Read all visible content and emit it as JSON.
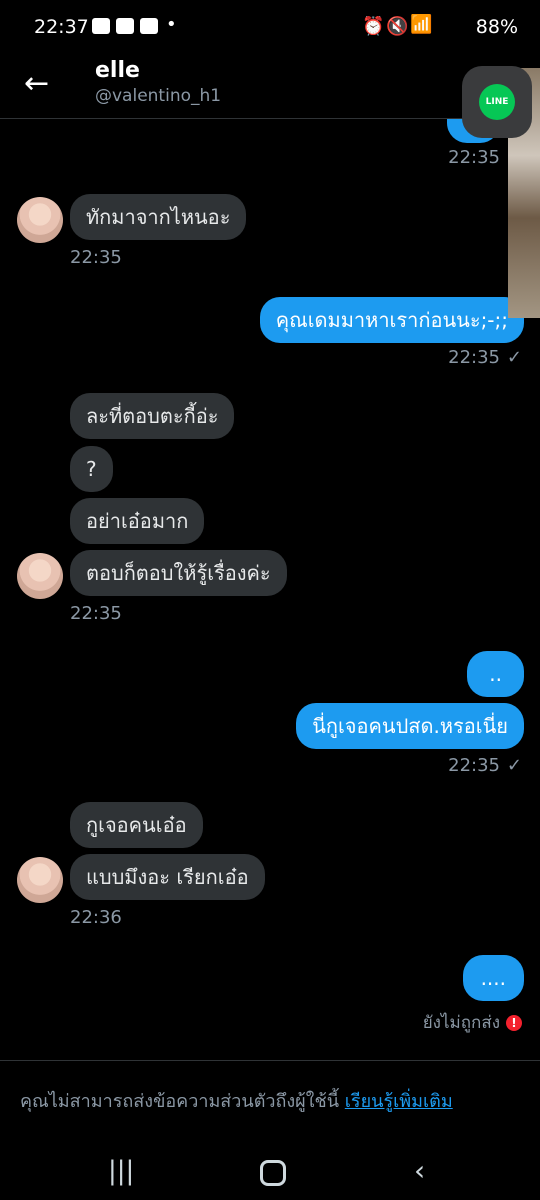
{
  "status_bar": {
    "time": "22:37",
    "battery": "88%"
  },
  "header": {
    "name": "elle",
    "handle": "@valentino_h1",
    "back_icon": "back-arrow-icon"
  },
  "floating_app": {
    "label": "LINE"
  },
  "messages": {
    "m0": {
      "text": "??",
      "time": "22:35"
    },
    "m1": {
      "text": "ทักมาจากไหนอะ",
      "time": "22:35"
    },
    "m2": {
      "text": "คุณเดมมาหาเราก่อนนะ;-;;",
      "time": "22:35"
    },
    "m3": {
      "text": "ละที่ตอบตะกี้อ่ะ"
    },
    "m4": {
      "text": "?"
    },
    "m5": {
      "text": "อย่าเอ๋อมาก"
    },
    "m6": {
      "text": "ตอบก็ตอบให้รู้เรื่องค่ะ",
      "time": "22:35"
    },
    "m7": {
      "text": ".."
    },
    "m8": {
      "text": "นี่กูเจอคนปสด.หรอเนี่ย",
      "time": "22:35"
    },
    "m9": {
      "text": "กูเจอคนเอ๋อ"
    },
    "m10": {
      "text": "แบบมึงอะ เรียกเอ๋อ",
      "time": "22:36"
    },
    "m11": {
      "text": "....",
      "status": "ยังไม่ถูกส่ง"
    }
  },
  "footer": {
    "notice": "คุณไม่สามารถส่งข้อความส่วนตัวถึงผู้ใช้นี้",
    "link": "เรียนรู้เพิ่มเติม"
  },
  "colors": {
    "outgoing": "#1d9bf0",
    "incoming": "#2f3336",
    "error": "#f4212e"
  }
}
